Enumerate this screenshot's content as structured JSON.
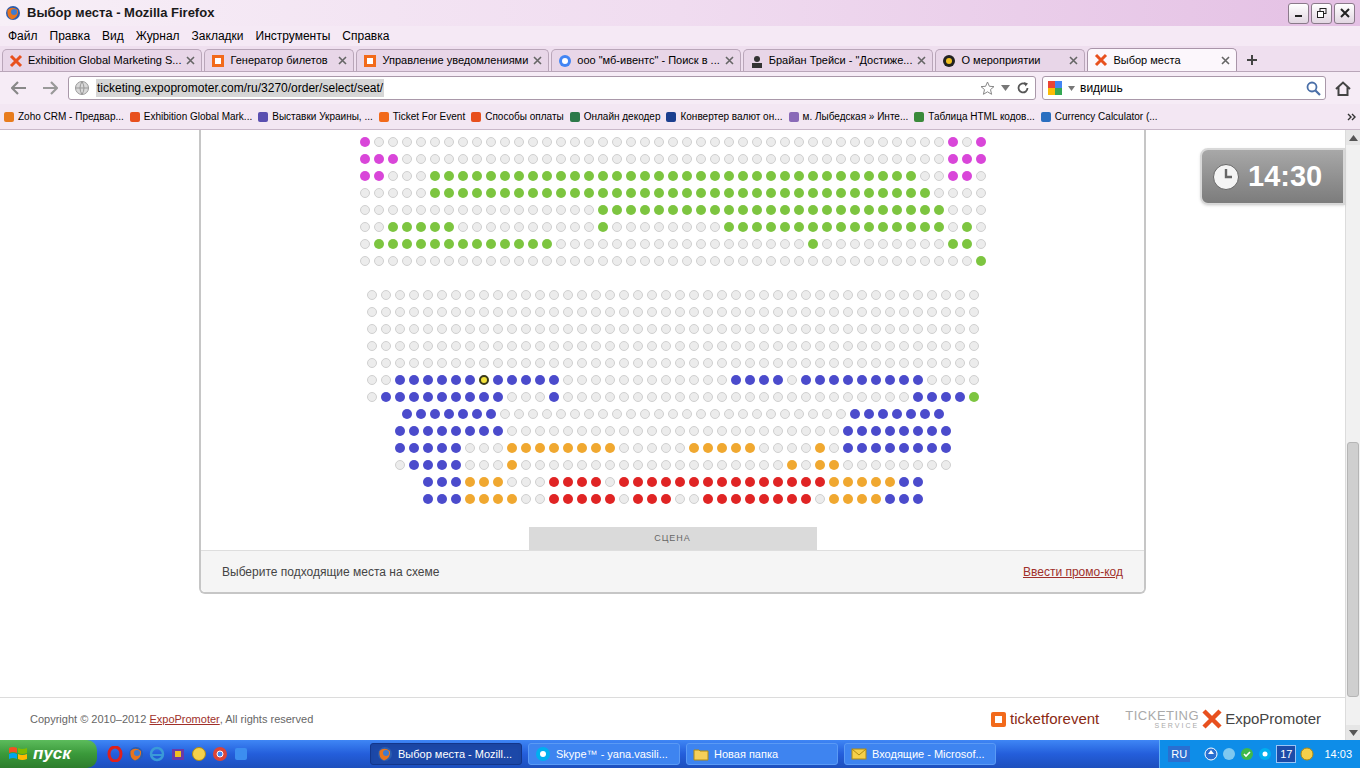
{
  "window": {
    "title": "Выбор места - Mozilla Firefox"
  },
  "menu": [
    "Файл",
    "Правка",
    "Вид",
    "Журнал",
    "Закладки",
    "Инструменты",
    "Справка"
  ],
  "tabs": [
    {
      "label": "Exhibition Global Marketing S...",
      "selected": false
    },
    {
      "label": "Генератор билетов",
      "selected": false
    },
    {
      "label": "Управление уведомлениями",
      "selected": false
    },
    {
      "label": "ооо \"мб-ивентс\" - Поиск в ...",
      "selected": false
    },
    {
      "label": "Брайан Трейси - \"Достиже...",
      "selected": false
    },
    {
      "label": "О мероприятии",
      "selected": false
    },
    {
      "label": "Выбор места",
      "selected": true
    }
  ],
  "address": {
    "url": "ticketing.expopromoter.com/ru/3270/order/select/seat/",
    "highlighted": true
  },
  "search": {
    "value": "видишь"
  },
  "bookmarks": [
    "Zoho CRM - Предвар...",
    "Exhibition Global Mark...",
    "Выставки Украины, ...",
    "Ticket For Event",
    "Способы оплаты",
    "Онлайн декодер",
    "Конвертер валют он...",
    "м. Лыбедская » Инте...",
    "Таблица HTML кодов...",
    "Currency Calculator (..."
  ],
  "seatmap": {
    "categories": [
      {
        "code": "x",
        "color": "#ececec"
      },
      {
        "code": "p",
        "color": "#d946d9"
      },
      {
        "code": "g",
        "color": "#7dc540"
      },
      {
        "code": "b",
        "color": "#4b4bcc"
      },
      {
        "code": "o",
        "color": "#f0a830"
      },
      {
        "code": "r",
        "color": "#e02424"
      },
      {
        "code": "s",
        "color": "#f3e23c"
      }
    ],
    "sections": [
      {
        "rows": [
          {
            "runs": [
              [
                "p",
                1
              ],
              [
                "x",
                41
              ],
              [
                "p",
                1
              ],
              [
                "x",
                1
              ],
              [
                "p",
                1
              ]
            ]
          },
          {
            "runs": [
              [
                "p",
                3
              ],
              [
                "x",
                39
              ],
              [
                "p",
                3
              ]
            ]
          },
          {
            "runs": [
              [
                "p",
                2
              ],
              [
                "x",
                3
              ],
              [
                "g",
                35
              ],
              [
                "x",
                2
              ],
              [
                "p",
                2
              ],
              [
                "x",
                1
              ]
            ]
          },
          {
            "runs": [
              [
                "x",
                5
              ],
              [
                "g",
                36
              ],
              [
                "x",
                4
              ]
            ]
          },
          {
            "runs": [
              [
                "x",
                17
              ],
              [
                "g",
                25
              ],
              [
                "x",
                3
              ]
            ]
          },
          {
            "runs": [
              [
                "x",
                2
              ],
              [
                "g",
                5
              ],
              [
                "x",
                10
              ],
              [
                "g",
                1
              ],
              [
                "x",
                8
              ],
              [
                "g",
                16
              ],
              [
                "x",
                1
              ],
              [
                "g",
                1
              ],
              [
                "x",
                1
              ]
            ]
          },
          {
            "runs": [
              [
                "x",
                1
              ],
              [
                "g",
                13
              ],
              [
                "x",
                18
              ],
              [
                "g",
                1
              ],
              [
                "x",
                9
              ],
              [
                "g",
                2
              ],
              [
                "x",
                1
              ]
            ]
          },
          {
            "runs": [
              [
                "x",
                44
              ],
              [
                "g",
                1
              ]
            ]
          }
        ]
      },
      {
        "rows": [
          {
            "runs": [
              [
                "x",
                44
              ]
            ]
          },
          {
            "runs": [
              [
                "x",
                44
              ]
            ]
          },
          {
            "runs": [
              [
                "x",
                44
              ]
            ]
          },
          {
            "runs": [
              [
                "x",
                44
              ]
            ]
          },
          {
            "runs": [
              [
                "x",
                44
              ]
            ]
          },
          {
            "runs": [
              [
                "x",
                2
              ],
              [
                "b",
                6
              ],
              [
                "s",
                1
              ],
              [
                "b",
                5
              ],
              [
                "x",
                12
              ],
              [
                "b",
                4
              ],
              [
                "x",
                1
              ],
              [
                "b",
                9
              ],
              [
                "x",
                4
              ]
            ]
          },
          {
            "runs": [
              [
                "x",
                1
              ],
              [
                "b",
                9
              ],
              [
                "x",
                3
              ],
              [
                "b",
                1
              ],
              [
                "x",
                25
              ],
              [
                "b",
                4
              ],
              [
                "g",
                1
              ]
            ]
          },
          {
            "runs": [
              [
                "b",
                7
              ],
              [
                "x",
                25
              ],
              [
                "b",
                7
              ]
            ]
          },
          {
            "runs": [
              [
                "b",
                8
              ],
              [
                "x",
                24
              ],
              [
                "b",
                8
              ]
            ]
          },
          {
            "runs": [
              [
                "b",
                5
              ],
              [
                "x",
                3
              ],
              [
                "o",
                8
              ],
              [
                "x",
                5
              ],
              [
                "o",
                5
              ],
              [
                "x",
                4
              ],
              [
                "o",
                1
              ],
              [
                "x",
                1
              ],
              [
                "b",
                8
              ]
            ]
          },
          {
            "runs": [
              [
                "x",
                1
              ],
              [
                "b",
                4
              ],
              [
                "x",
                3
              ],
              [
                "o",
                1
              ],
              [
                "x",
                19
              ],
              [
                "o",
                1
              ],
              [
                "x",
                1
              ],
              [
                "o",
                2
              ],
              [
                "x",
                8
              ]
            ]
          },
          {
            "runs": [
              [
                "b",
                3
              ],
              [
                "o",
                3
              ],
              [
                "x",
                3
              ],
              [
                "r",
                4
              ],
              [
                "x",
                1
              ],
              [
                "r",
                15
              ],
              [
                "o",
                5
              ],
              [
                "b",
                2
              ]
            ]
          },
          {
            "runs": [
              [
                "b",
                3
              ],
              [
                "o",
                4
              ],
              [
                "x",
                2
              ],
              [
                "r",
                5
              ],
              [
                "x",
                1
              ],
              [
                "r",
                3
              ],
              [
                "x",
                2
              ],
              [
                "r",
                8
              ],
              [
                "x",
                1
              ],
              [
                "o",
                4
              ],
              [
                "b",
                3
              ]
            ]
          }
        ]
      }
    ],
    "stage": "СЦЕНА",
    "hint": "Выберите подходящие места на схеме",
    "promo": "Ввести промо-код"
  },
  "clock": {
    "time": "14:30"
  },
  "footer": {
    "copyright": "Copyright © 2010–2012 ",
    "link": "ExpoPromoter",
    "rights": ", All rights reserved",
    "logos": {
      "tfe": "ticketforevent",
      "ticketing": "TICKETING",
      "service": "SERVICE",
      "brand": "ExpoPromoter"
    }
  },
  "taskbar": {
    "start": "пуск",
    "tasks": [
      {
        "label": "Выбор места - Mozill...",
        "selected": true
      },
      {
        "label": "Skype™ - yana.vasili...",
        "selected": false
      },
      {
        "label": "Новая папка",
        "selected": false
      },
      {
        "label": "Входящие - Microsof...",
        "selected": false
      }
    ],
    "language": "RU",
    "badge": "17",
    "time": "14:03"
  }
}
